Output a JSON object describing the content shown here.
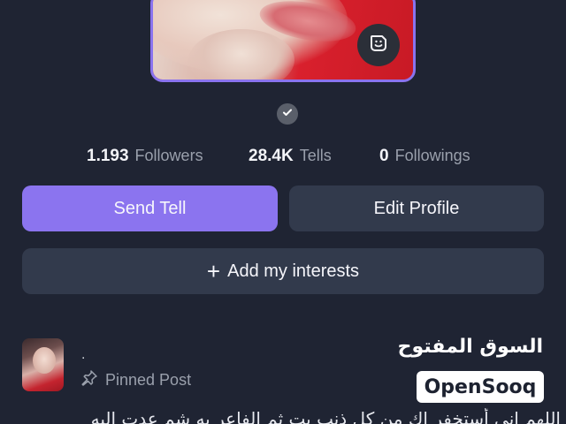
{
  "profile": {
    "verified_icon": "check-badge-icon",
    "sticker_icon": "sticker-icon",
    "accent": "#8b74ef"
  },
  "stats": [
    {
      "value": "1.193",
      "label": "Followers"
    },
    {
      "value": "28.4K",
      "label": "Tells"
    },
    {
      "value": "0",
      "label": "Followings"
    }
  ],
  "actions": {
    "send_tell": "Send Tell",
    "edit_profile": "Edit Profile",
    "add_interests": "Add my interests"
  },
  "post": {
    "author_name": ".",
    "pinned_label": "Pinned Post",
    "text": "اللهم إني أستخفر اك من كل ذنب بت ثم الفاعر به شم عدت اليه"
  },
  "watermark": {
    "arabic": "السوق المفتوح",
    "brand": "OpenSooq"
  }
}
